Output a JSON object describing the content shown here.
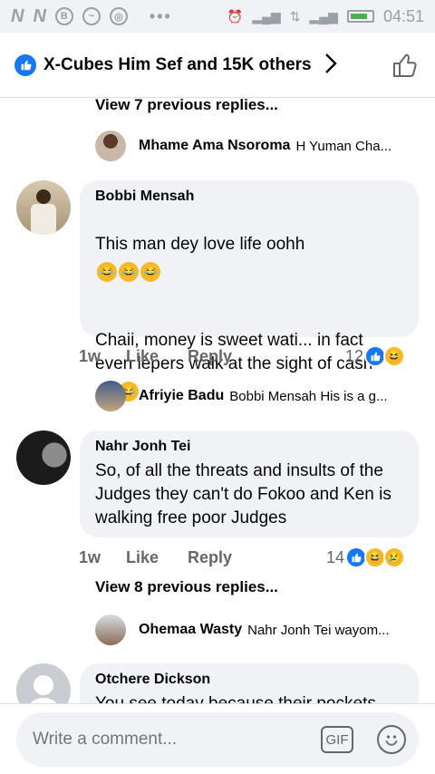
{
  "status_bar": {
    "time": "04:51"
  },
  "header": {
    "title": "X-Cubes Him Sef and 15K others"
  },
  "thread": [
    {
      "type": "view_more",
      "label": "View 7 previous replies..."
    },
    {
      "type": "reply_preview",
      "name": "Mhame Ama Nsoroma",
      "text": "H Yuman Cha..."
    },
    {
      "type": "comment",
      "name": "Bobbi Mensah",
      "text_line1": "This man dey love life oohh",
      "text_line2": "Chaii, money is sweet wati... in fact even lepers walk at the sight of cash",
      "time": "1w",
      "like": "Like",
      "reply": "Reply",
      "reaction_count": "12",
      "reactions": [
        "like",
        "haha"
      ]
    },
    {
      "type": "reply_preview",
      "name": "Afriyie Badu",
      "text": "Bobbi Mensah His is a g..."
    },
    {
      "type": "comment",
      "name": "Nahr Jonh Tei",
      "text": "So, of all the threats and insults of the Judges  they can't do Fokoo and Ken is walking free poor Judges",
      "time": "1w",
      "like": "Like",
      "reply": "Reply",
      "reaction_count": "14",
      "reactions": [
        "like",
        "haha",
        "sad"
      ]
    },
    {
      "type": "view_more",
      "label": "View 8 previous replies..."
    },
    {
      "type": "reply_preview",
      "name": "Ohemaa Wasty",
      "text": "Nahr Jonh Tei wayom..."
    },
    {
      "type": "comment",
      "name": "Otchere Dickson",
      "text": "You see today because their pockets"
    }
  ],
  "composer": {
    "placeholder": "Write a comment...",
    "gif_label": "GIF"
  },
  "colors": {
    "accent": "#1877f2",
    "bubble": "#f0f2f5",
    "reaction_yellow": "#f7b928"
  }
}
